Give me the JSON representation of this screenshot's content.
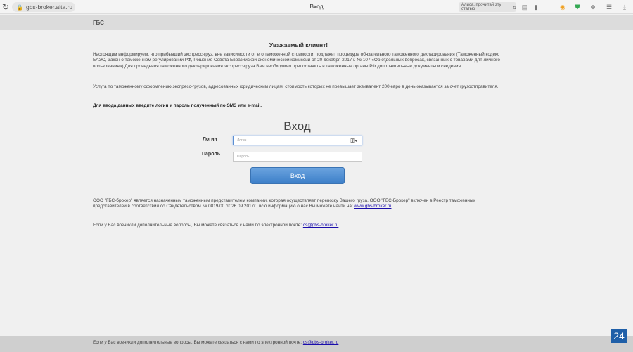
{
  "browser": {
    "url": "gbs-broker.alta.ru",
    "tab_title": "Вход",
    "read_aloud": "Алиса, прочитай эту статью"
  },
  "site": {
    "title": "ГБС"
  },
  "notice": {
    "greeting": "Уважаемый клиент!",
    "paragraph1": "Настоящим информируем, что прибывший экспресс-груз, вне зависимости от его таможенной стоимости, подлежит процедуре обязательного таможенного декларирования (Таможенный кодекс ЕАЭС, Закон о таможенном регулировании РФ, Решение Совета Евразийской экономической комиссии от 20 декабря 2017 г. № 107 «Об отдельных вопросах, связанных с товарами для личного пользования») Для проведения таможенного декларирования экспресс-груза Вам необходимо предоставить в таможенные органы РФ дополнительные документы и сведения.",
    "paragraph2": "Услуга по таможенному оформлению экспресс-грузов, адресованных юридическим лицам, стоимость которых не превышает эквивалент 200 евро в день оказывается за счет грузоотправителя.",
    "instruction": "Для ввода данных введите логин и пароль полученный по SMS или e-mail."
  },
  "login_form": {
    "heading": "Вход",
    "login_label": "Логин",
    "login_placeholder": "Логин",
    "password_label": "Пароль",
    "password_placeholder": "Пароль",
    "submit_label": "Вход"
  },
  "info": {
    "representative_text": "ООО \"ГБС-брокер\" является назначенным таможенным представителем компании, которая осуществляет перевозку Вашего груза. ООО \"ГБС-Брокер\" включен в Реестр таможенных представителей в соответствии со Свидетельством № 0819/00 от 26.09.2017г., всю информацию о нас Вы можете найти на: ",
    "website_link": "www.gbs-broker.ru",
    "contact_text": "Если у Вас возникли дополнительные вопросы, Вы можете связаться с нами по электронной почте: ",
    "email_link": "cs@gbs-broker.ru"
  },
  "footer": {
    "contact_text": "Если у Вас возникли дополнительные вопросы, Вы можете связаться с нами по электронной почте: ",
    "email_link": "cs@gbs-broker.ru"
  },
  "badge": {
    "text": "24"
  }
}
